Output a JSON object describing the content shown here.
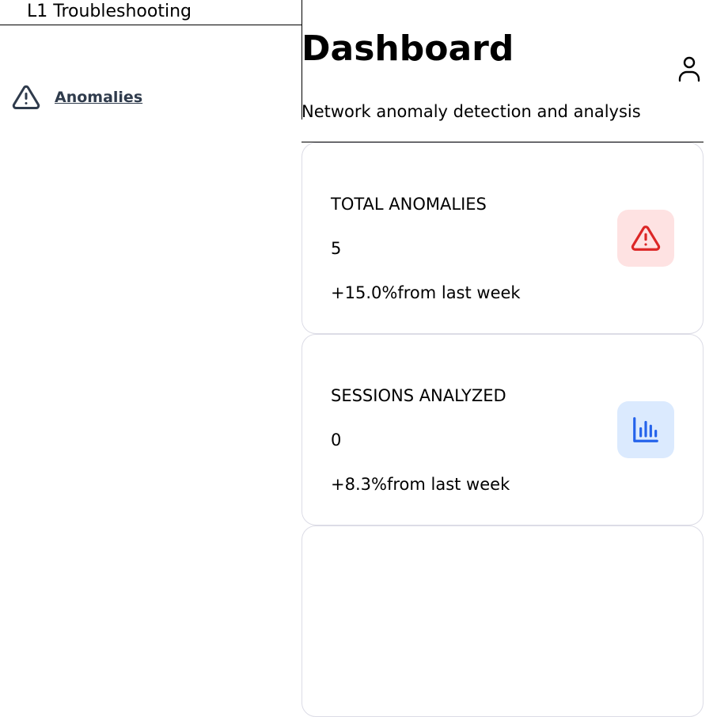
{
  "sidebar": {
    "brand": "L1 Troubleshooting",
    "items": [
      {
        "label": "Anomalies",
        "icon": "warning-triangle-icon"
      }
    ]
  },
  "header": {
    "title": "Dashboard",
    "subtitle": "Network anomaly detection and analysis",
    "user_icon": "user-icon"
  },
  "stats": [
    {
      "label": "TOTAL ANOMALIES",
      "value": "5",
      "change": "+15.0%",
      "change_suffix": "from last week",
      "icon": "alert-triangle-icon",
      "icon_color": "#dc2626",
      "icon_bg": "#fee2e2"
    },
    {
      "label": "SESSIONS ANALYZED",
      "value": "0",
      "change": "+8.3%",
      "change_suffix": "from last week",
      "icon": "bar-chart-icon",
      "icon_color": "#2563eb",
      "icon_bg": "#dbeafe"
    }
  ],
  "colors": {
    "nav_text": "#2f3b4c",
    "card_border": "#dcdce6"
  }
}
